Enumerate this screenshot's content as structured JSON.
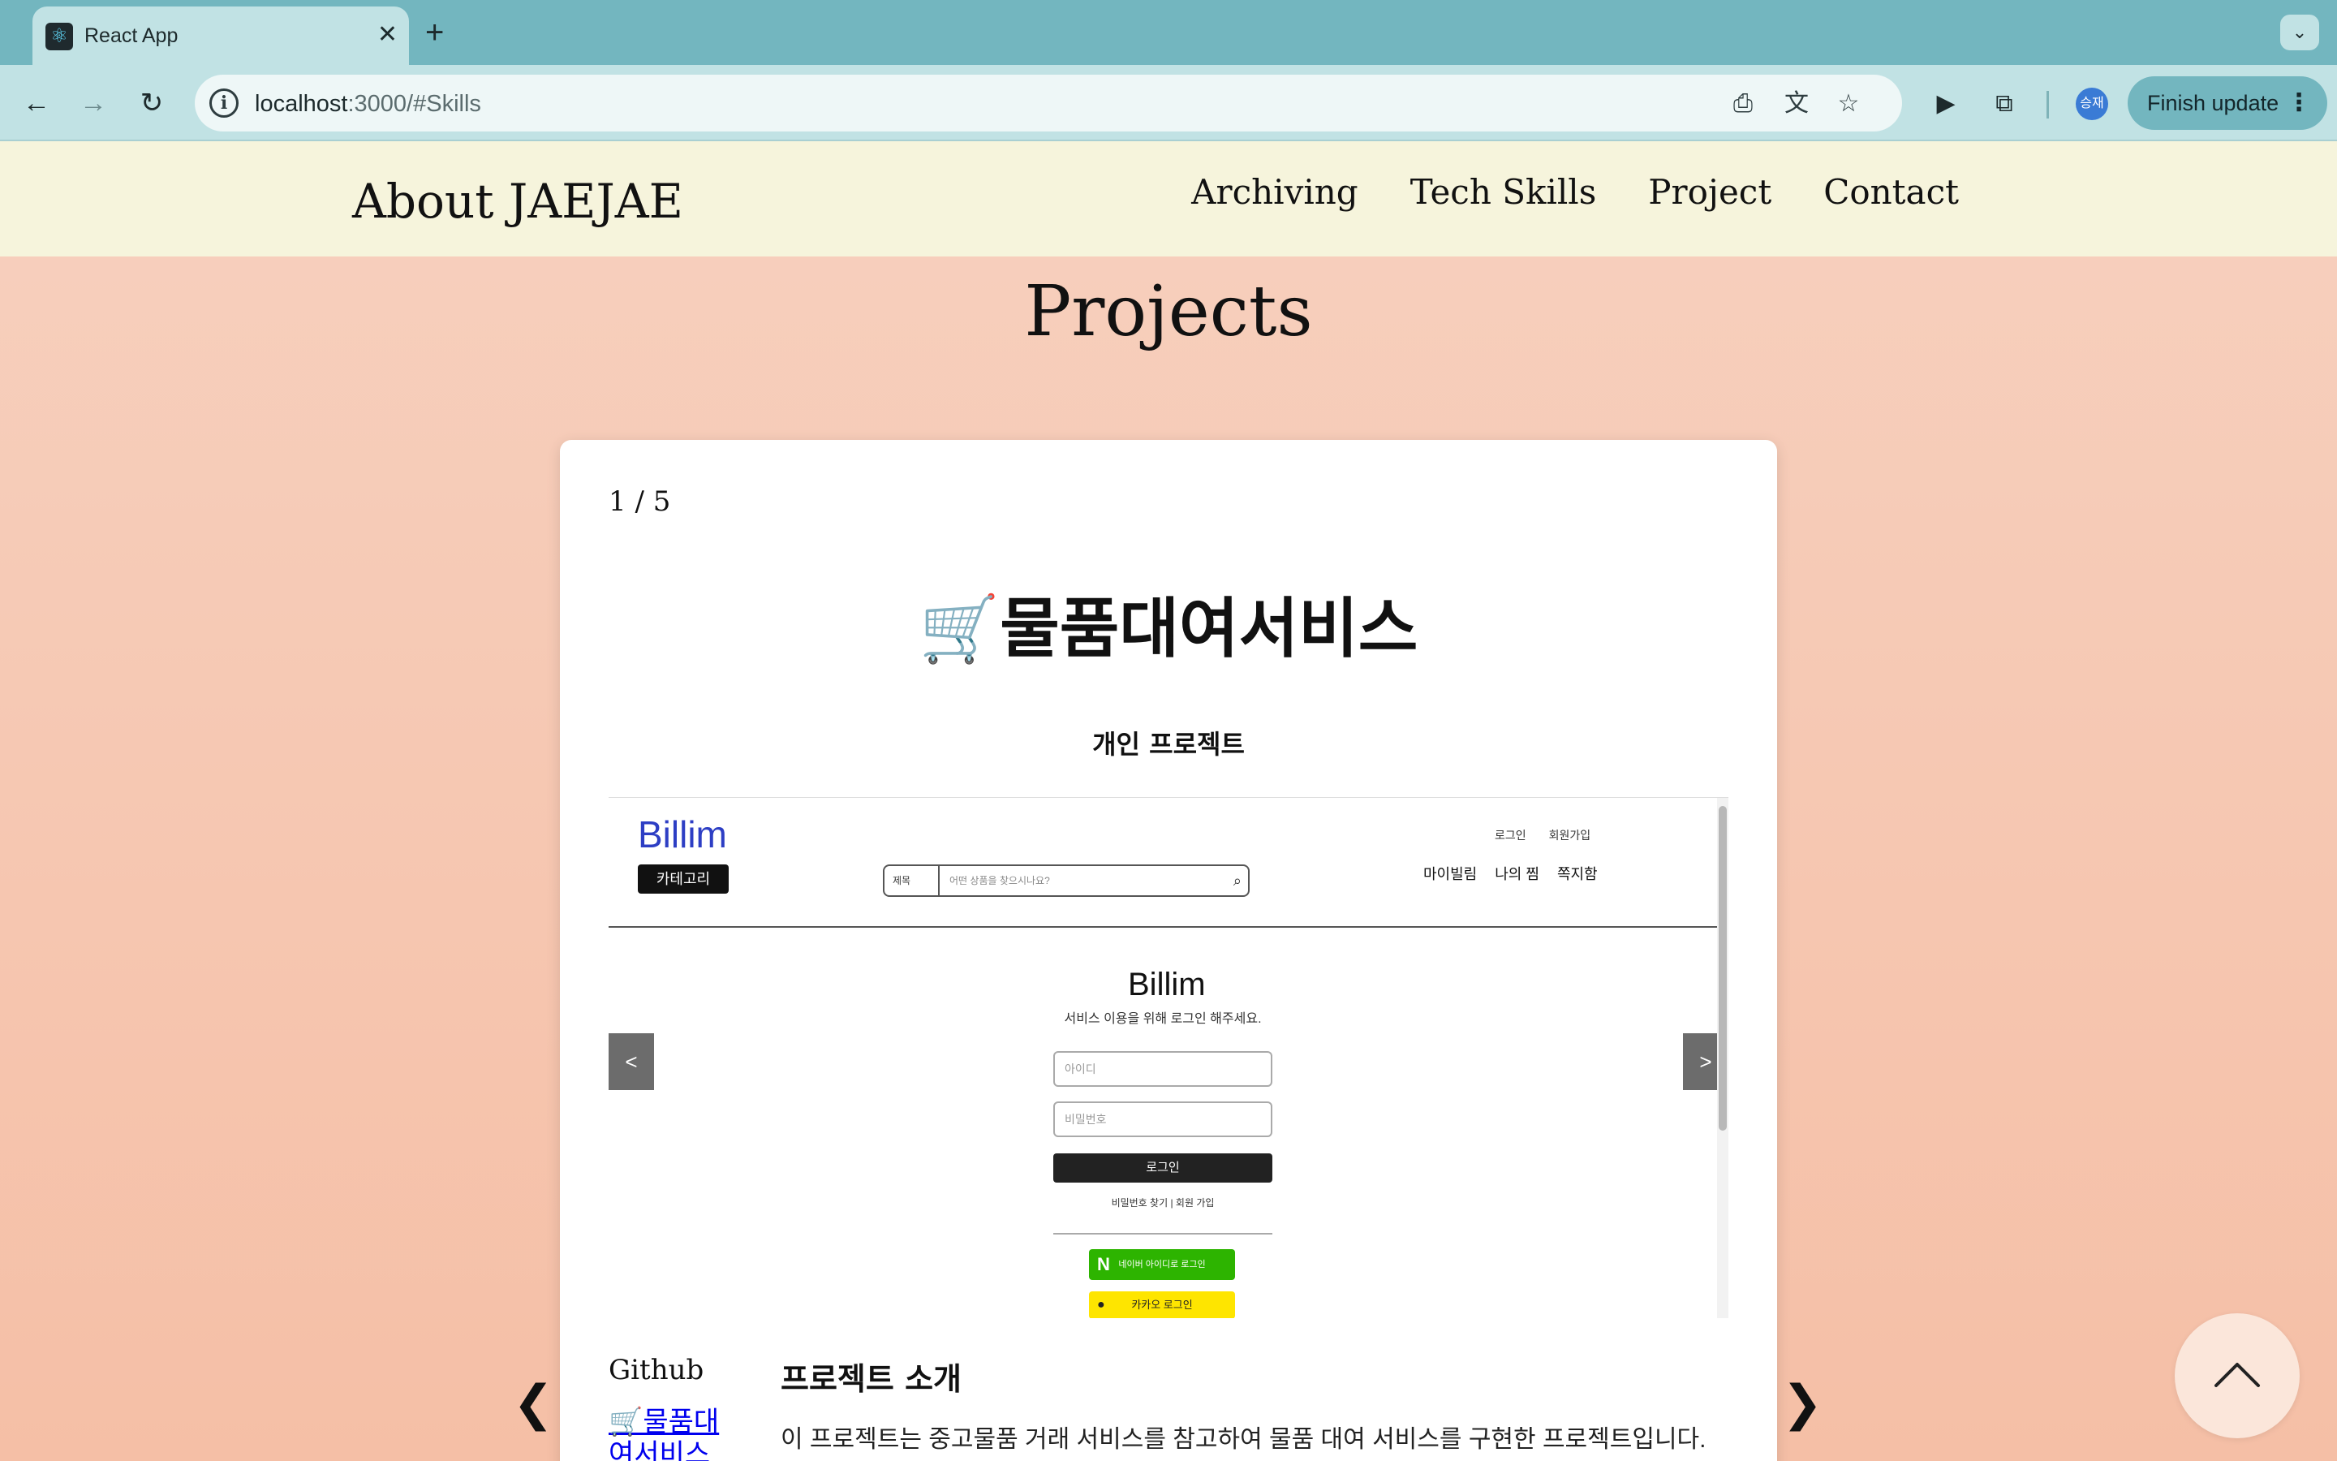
{
  "browser": {
    "tab_title": "React App",
    "url_host": "localhost",
    "url_rest": ":3000/#Skills",
    "profile_initials": "승재",
    "finish_update_label": "Finish update",
    "icons": [
      "react-favicon-icon",
      "close-icon",
      "plus-icon",
      "chevron-down-icon",
      "back-icon",
      "forward-icon",
      "reload-icon",
      "info-icon",
      "install-icon",
      "translate-icon",
      "star-icon",
      "camera-icon",
      "extensions-icon",
      "more-icon"
    ]
  },
  "site": {
    "logo": "About JAEJAE",
    "nav": [
      "Archiving",
      "Tech Skills",
      "Project",
      "Contact"
    ],
    "section_title": "Projects"
  },
  "project": {
    "counter": "1 / 5",
    "title": "🛒물품대여서비스",
    "subtitle": "개인 프로젝트",
    "github_label": "Github",
    "github_link": "🛒물품대여서비스",
    "intro_title": "프로젝트 소개",
    "intro_text": "이 프로젝트는 중고물품 거래 서비스를 참고하여 물품 대여 서비스를 구현한 프로젝트입니다."
  },
  "screenshot": {
    "logo": "Billim",
    "category_button": "카테고리",
    "search_category": "제목",
    "search_placeholder": "어떤 상품을 찾으시나요?",
    "top_links": [
      "로그인",
      "회원가입"
    ],
    "menu": [
      "마이빌림",
      "나의 찜",
      "쪽지함"
    ],
    "login_title": "Billim",
    "login_desc": "서비스 이용을 위해 로그인 해주세요.",
    "id_placeholder": "아이디",
    "pw_placeholder": "비밀번호",
    "login_button": "로그인",
    "find_links": "비밀번호 찾기 | 회원 가입",
    "naver_button": "네이버 아이디로 로그인",
    "kakao_button": "카카오 로그인",
    "prev": "<",
    "next": ">"
  },
  "carousel": {
    "prev": "❮",
    "next": "❯"
  }
}
